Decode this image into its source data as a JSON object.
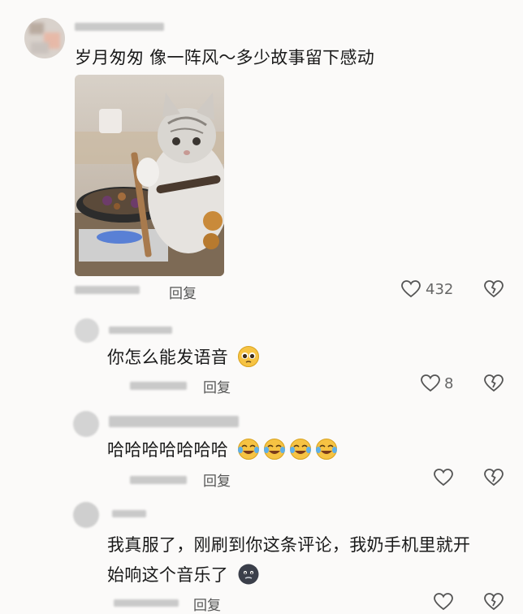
{
  "comments": [
    {
      "text": "岁月匆匆 像一阵风～多少故事留下感动",
      "reply_label": "回复",
      "likes": "432",
      "has_image": true,
      "image_icon": "cat-cooking-photo"
    },
    {
      "text": "你怎么能发语音",
      "emoji": [
        "pleading-face-emoji"
      ],
      "reply_label": "回复",
      "likes": "8"
    },
    {
      "text": "哈哈哈哈哈哈哈",
      "emoji": [
        "tears-of-joy-emoji",
        "tears-of-joy-emoji",
        "tears-of-joy-emoji",
        "tears-of-joy-emoji"
      ],
      "reply_label": "回复",
      "likes": ""
    },
    {
      "text_line1": "我真服了，刚刷到你这条评论，我奶手机里就开",
      "text_line2": "始响这个音乐了",
      "emoji": [
        "dark-round-face-emoji"
      ],
      "reply_label": "回复",
      "likes": ""
    }
  ],
  "icons": {
    "like": "heart-outline-icon",
    "dislike": "broken-heart-icon"
  },
  "colors": {
    "background": "#fbfaf9",
    "text": "#1a1a1a",
    "muted": "#666666",
    "emoji_yellow": "#f6c343"
  }
}
